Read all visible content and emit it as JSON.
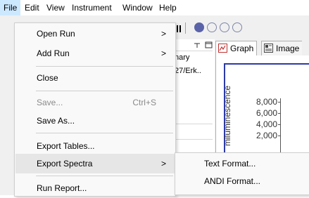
{
  "menubar": {
    "items": [
      {
        "label": "File"
      },
      {
        "label": "Edit"
      },
      {
        "label": "View"
      },
      {
        "label": "Instrument"
      },
      {
        "label": "Window"
      },
      {
        "label": "Help"
      }
    ]
  },
  "file_menu": {
    "items": [
      {
        "label": "Open Run",
        "arrow": ">"
      },
      {
        "label": "Add Run",
        "arrow": ">"
      },
      {
        "label": "Close"
      },
      {
        "label": "Save...",
        "shortcut": "Ctrl+S"
      },
      {
        "label": "Save As..."
      },
      {
        "label": "Export Tables..."
      },
      {
        "label": "Export Spectra",
        "arrow": ">"
      },
      {
        "label": "Run Report..."
      }
    ]
  },
  "submenu": {
    "items": [
      {
        "label": "Text Format..."
      },
      {
        "label": "ANDI Format..."
      }
    ]
  },
  "left_panel": {
    "text1": "nary",
    "text2": "27/Erk.."
  },
  "tabs": [
    {
      "label": "Graph"
    },
    {
      "label": "Image"
    }
  ],
  "graph": {
    "ylabel": "miluminescence",
    "yticks": [
      "8,000",
      "6,000",
      "4,000",
      "2,000"
    ]
  },
  "colors": {
    "menu_highlight": "#e6e6e6",
    "menubar_active": "#cce8ff",
    "graph_border": "#2b3aa8"
  }
}
